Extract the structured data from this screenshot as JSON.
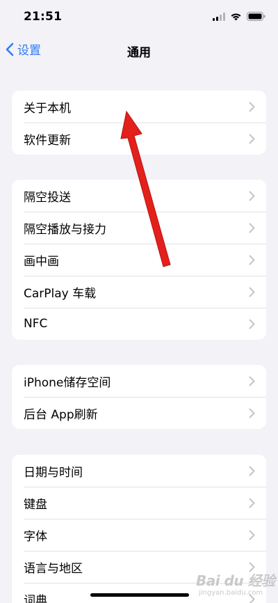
{
  "status_bar": {
    "time": "21:51"
  },
  "nav": {
    "back_label": "设置",
    "title": "通用"
  },
  "groups": [
    {
      "rows": [
        {
          "label": "关于本机"
        },
        {
          "label": "软件更新"
        }
      ]
    },
    {
      "rows": [
        {
          "label": "隔空投送"
        },
        {
          "label": "隔空播放与接力"
        },
        {
          "label": "画中画"
        },
        {
          "label": "CarPlay 车载"
        },
        {
          "label": "NFC"
        }
      ]
    },
    {
      "rows": [
        {
          "label": "iPhone储存空间"
        },
        {
          "label": "后台 App刷新"
        }
      ]
    },
    {
      "rows": [
        {
          "label": "日期与时间"
        },
        {
          "label": "键盘"
        },
        {
          "label": "字体"
        },
        {
          "label": "语言与地区"
        },
        {
          "label": "词典"
        }
      ]
    }
  ],
  "watermark": {
    "brand": "Bai du 经验",
    "url": "jingyan.baidu.com"
  },
  "colors": {
    "accent": "#2f7cf6",
    "background": "#f2f2f7",
    "annotation_arrow": "#e3201b"
  }
}
